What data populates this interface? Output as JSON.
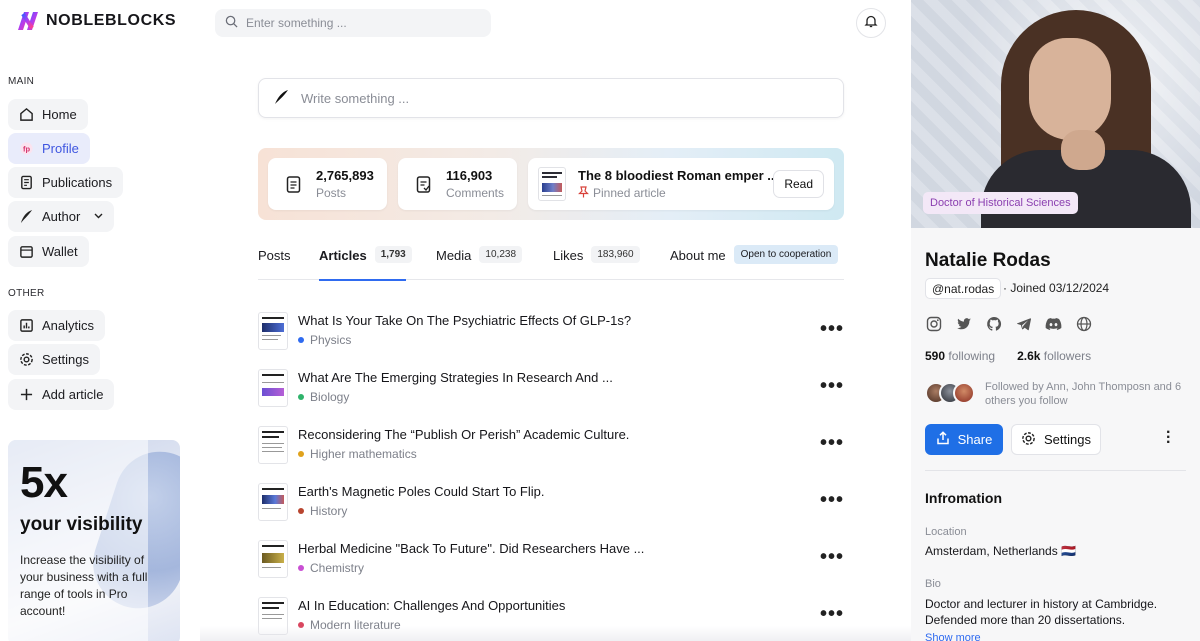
{
  "brand": {
    "name": "NOBLEBLOCKS"
  },
  "search": {
    "placeholder": "Enter something ..."
  },
  "sidebar": {
    "main_label": "MAIN",
    "other_label": "OTHER",
    "main_items": [
      {
        "label": "Home",
        "icon": "home-icon"
      },
      {
        "label": "Profile",
        "icon": "profile-icon",
        "active": true
      },
      {
        "label": "Publications",
        "icon": "publications-icon"
      },
      {
        "label": "Author",
        "icon": "quill-icon"
      },
      {
        "label": "Wallet",
        "icon": "wallet-icon"
      }
    ],
    "other_items": [
      {
        "label": "Analytics",
        "icon": "analytics-icon"
      },
      {
        "label": "Settings",
        "icon": "gear-icon"
      },
      {
        "label": "Add article",
        "icon": "plus-icon"
      }
    ]
  },
  "promo": {
    "big": "5x",
    "title": "your visibility",
    "text": "Increase the visibility of your business with a full range of tools in Pro account!"
  },
  "composer": {
    "placeholder": "Write something ..."
  },
  "stats": {
    "posts": {
      "value": "2,765,893",
      "label": "Posts"
    },
    "comments": {
      "value": "116,903",
      "label": "Comments"
    },
    "pinned": {
      "title": "The 8 bloodiest Roman emper ...",
      "label": "Pinned article",
      "button": "Read"
    }
  },
  "tabs": [
    {
      "label": "Posts",
      "count": ""
    },
    {
      "label": "Articles",
      "count": "1,793",
      "active": true
    },
    {
      "label": "Media",
      "count": "10,238"
    },
    {
      "label": "Likes",
      "count": "183,960"
    },
    {
      "label": "About me",
      "badge": "Open to cooperation"
    }
  ],
  "articles": [
    {
      "title": "What Is Your Take On The Psychiatric Effects Of GLP-1s?",
      "category": "Physics",
      "color": "#2f6bf0"
    },
    {
      "title": "What Are The Emerging Strategies In Research And ...",
      "category": "Biology",
      "color": "#2fb36b"
    },
    {
      "title": "Reconsidering The “Publish Or Perish” Academic Culture.",
      "category": "Higher mathematics",
      "color": "#e0a21c"
    },
    {
      "title": "Earth's Magnetic Poles Could Start To Flip.",
      "category": "History",
      "color": "#b8452f"
    },
    {
      "title": "Herbal Medicine \"Back To Future\". Did Researchers Have ...",
      "category": "Chemistry",
      "color": "#c94fd3"
    },
    {
      "title": "AI In Education: Challenges And Opportunities",
      "category": "Modern literature",
      "color": "#d9465f"
    }
  ],
  "profile": {
    "role": "Doctor of Historical Sciences",
    "name": "Natalie Rodas",
    "handle": "@nat.rodas",
    "joined": "Joined 03/12/2024",
    "socials": [
      "instagram-icon",
      "twitter-icon",
      "github-icon",
      "telegram-icon",
      "discord-icon",
      "globe-icon"
    ],
    "following_count": "590",
    "following_label": "following",
    "followers_count": "2.6k",
    "followers_label": "followers",
    "followed_by": "Followed by Ann, John Thomposn and 6 others you follow",
    "share_label": "Share",
    "settings_label": "Settings",
    "info_title": "Infromation",
    "location_label": "Location",
    "location_value": "Amsterdam, Netherlands 🇳🇱",
    "bio_label": "Bio",
    "bio_value": "Doctor and lecturer in history at Cambridge. Defended more than 20 dissertations.",
    "show_more": "Show more"
  }
}
